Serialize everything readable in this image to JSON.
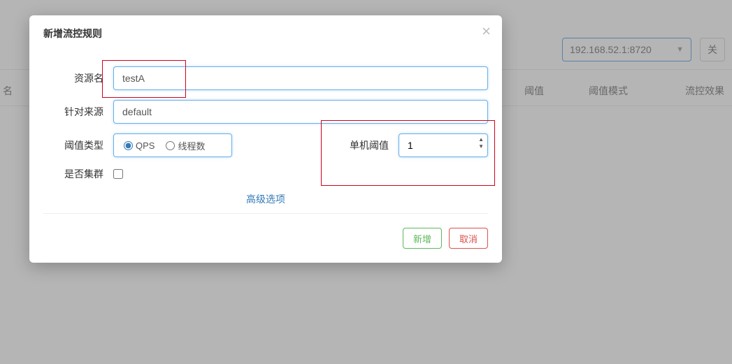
{
  "background": {
    "selector_value": "192.168.52.1:8720",
    "button_right": "关",
    "columns": {
      "c0": "名",
      "c1": "阈值",
      "c2": "阈值模式",
      "c3": "流控效果"
    }
  },
  "modal": {
    "title": "新增流控规则",
    "close": "×",
    "labels": {
      "resource": "资源名",
      "source": "针对来源",
      "threshold_type": "阈值类型",
      "single_threshold": "单机阈值",
      "cluster": "是否集群"
    },
    "fields": {
      "resource_value": "testA",
      "source_value": "default",
      "threshold_value": "1"
    },
    "radios": {
      "qps": "QPS",
      "threads": "线程数"
    },
    "advanced": "高级选项",
    "buttons": {
      "submit": "新增",
      "cancel": "取消"
    }
  }
}
